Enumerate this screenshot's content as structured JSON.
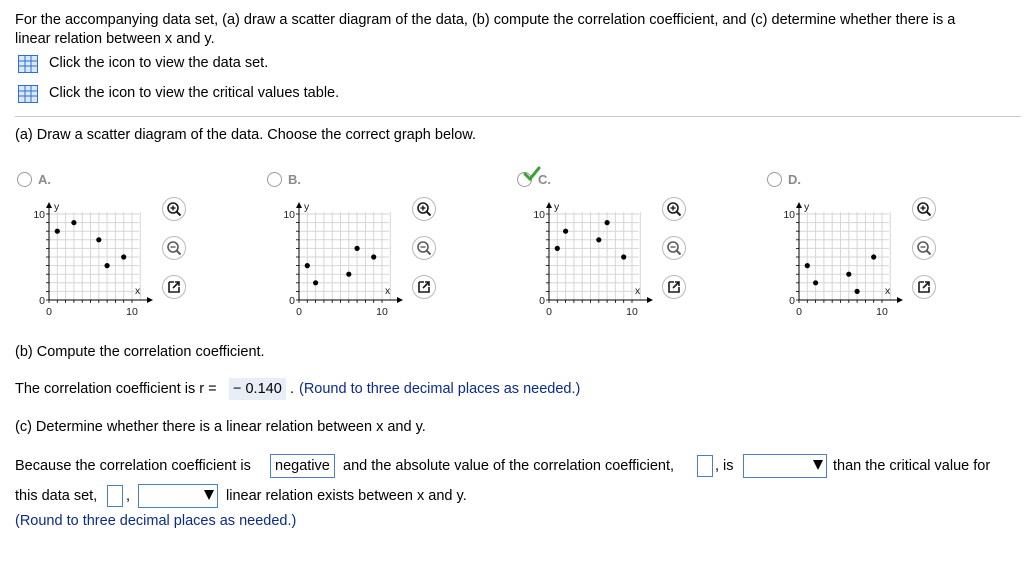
{
  "question": {
    "prompt_line1": "For the accompanying data set, (a) draw a scatter diagram of the data, (b) compute the correlation coefficient, and (c) determine whether there is a",
    "prompt_line2": "linear relation between x and y.",
    "dataset_link": "Click the icon to view the data set.",
    "critical_link": "Click the icon to view the critical values table."
  },
  "part_a": {
    "prompt": "(a) Draw a scatter diagram of the data. Choose the correct graph below.",
    "options": [
      {
        "label": "A.",
        "points": [
          [
            1,
            8
          ],
          [
            3,
            9
          ],
          [
            6,
            7
          ],
          [
            7,
            4
          ],
          [
            9,
            5
          ]
        ]
      },
      {
        "label": "B.",
        "points": [
          [
            1,
            4
          ],
          [
            2,
            2
          ],
          [
            6,
            3
          ],
          [
            7,
            6
          ],
          [
            9,
            5
          ]
        ]
      },
      {
        "label": "C.",
        "points": [
          [
            1,
            6
          ],
          [
            2,
            8
          ],
          [
            6,
            7
          ],
          [
            7,
            9
          ],
          [
            9,
            5
          ]
        ]
      },
      {
        "label": "D.",
        "points": [
          [
            1,
            4
          ],
          [
            2,
            2
          ],
          [
            6,
            3
          ],
          [
            7,
            1
          ],
          [
            9,
            5
          ]
        ]
      }
    ],
    "selected": "C.",
    "axis": {
      "xlabel": "x",
      "ylabel": "y",
      "min_label": "0",
      "max_label": "10",
      "ymax_label": "10",
      "ymin_label": "0",
      "xmin": 0,
      "xmax": 10,
      "ymin": 0,
      "ymax": 10
    },
    "icons": [
      "zoom-in-icon",
      "zoom-out-icon",
      "popout-icon"
    ],
    "check_color": "#3aa335"
  },
  "part_b": {
    "prompt": "(b) Compute the correlation coefficient.",
    "answer_prefix": "The correlation coefficient is r =",
    "answer_value": "− 0.140",
    "answer_suffix": ".",
    "hint": "(Round to three decimal places as needed.)"
  },
  "part_c": {
    "prompt": "(c) Determine whether there is a linear relation between x and y.",
    "sentence_start": "Because the correlation coefficient is",
    "correlation_sign": "negative",
    "sentence_mid1": "and the absolute value of the correlation coefficient,",
    "sentence_mid2": ", is",
    "sentence_mid3": "than the critical value for",
    "sentence_line2_start": "this data set,",
    "sentence_line2_comma": ",",
    "sentence_line2_end": "linear relation exists between x and y.",
    "hint": "(Round to three decimal places as needed.)"
  },
  "colors": {
    "link_blue": "#0b2b8c",
    "box_border": "#4a7fc1",
    "answer_bg": "#e8eef6"
  }
}
